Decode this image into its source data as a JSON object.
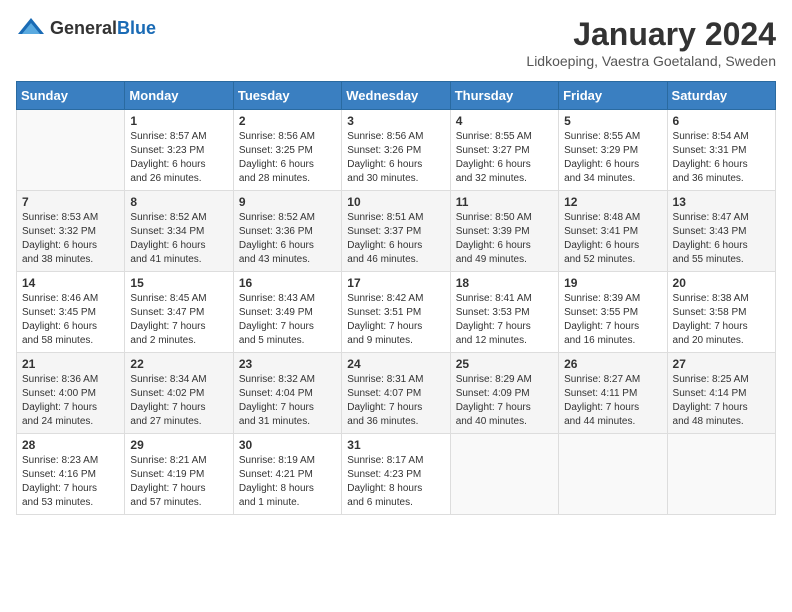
{
  "header": {
    "logo_general": "General",
    "logo_blue": "Blue",
    "month_title": "January 2024",
    "location": "Lidkoeping, Vaestra Goetaland, Sweden"
  },
  "days_of_week": [
    "Sunday",
    "Monday",
    "Tuesday",
    "Wednesday",
    "Thursday",
    "Friday",
    "Saturday"
  ],
  "weeks": [
    [
      {
        "day": "",
        "info": ""
      },
      {
        "day": "1",
        "info": "Sunrise: 8:57 AM\nSunset: 3:23 PM\nDaylight: 6 hours\nand 26 minutes."
      },
      {
        "day": "2",
        "info": "Sunrise: 8:56 AM\nSunset: 3:25 PM\nDaylight: 6 hours\nand 28 minutes."
      },
      {
        "day": "3",
        "info": "Sunrise: 8:56 AM\nSunset: 3:26 PM\nDaylight: 6 hours\nand 30 minutes."
      },
      {
        "day": "4",
        "info": "Sunrise: 8:55 AM\nSunset: 3:27 PM\nDaylight: 6 hours\nand 32 minutes."
      },
      {
        "day": "5",
        "info": "Sunrise: 8:55 AM\nSunset: 3:29 PM\nDaylight: 6 hours\nand 34 minutes."
      },
      {
        "day": "6",
        "info": "Sunrise: 8:54 AM\nSunset: 3:31 PM\nDaylight: 6 hours\nand 36 minutes."
      }
    ],
    [
      {
        "day": "7",
        "info": "Sunrise: 8:53 AM\nSunset: 3:32 PM\nDaylight: 6 hours\nand 38 minutes."
      },
      {
        "day": "8",
        "info": "Sunrise: 8:52 AM\nSunset: 3:34 PM\nDaylight: 6 hours\nand 41 minutes."
      },
      {
        "day": "9",
        "info": "Sunrise: 8:52 AM\nSunset: 3:36 PM\nDaylight: 6 hours\nand 43 minutes."
      },
      {
        "day": "10",
        "info": "Sunrise: 8:51 AM\nSunset: 3:37 PM\nDaylight: 6 hours\nand 46 minutes."
      },
      {
        "day": "11",
        "info": "Sunrise: 8:50 AM\nSunset: 3:39 PM\nDaylight: 6 hours\nand 49 minutes."
      },
      {
        "day": "12",
        "info": "Sunrise: 8:48 AM\nSunset: 3:41 PM\nDaylight: 6 hours\nand 52 minutes."
      },
      {
        "day": "13",
        "info": "Sunrise: 8:47 AM\nSunset: 3:43 PM\nDaylight: 6 hours\nand 55 minutes."
      }
    ],
    [
      {
        "day": "14",
        "info": "Sunrise: 8:46 AM\nSunset: 3:45 PM\nDaylight: 6 hours\nand 58 minutes."
      },
      {
        "day": "15",
        "info": "Sunrise: 8:45 AM\nSunset: 3:47 PM\nDaylight: 7 hours\nand 2 minutes."
      },
      {
        "day": "16",
        "info": "Sunrise: 8:43 AM\nSunset: 3:49 PM\nDaylight: 7 hours\nand 5 minutes."
      },
      {
        "day": "17",
        "info": "Sunrise: 8:42 AM\nSunset: 3:51 PM\nDaylight: 7 hours\nand 9 minutes."
      },
      {
        "day": "18",
        "info": "Sunrise: 8:41 AM\nSunset: 3:53 PM\nDaylight: 7 hours\nand 12 minutes."
      },
      {
        "day": "19",
        "info": "Sunrise: 8:39 AM\nSunset: 3:55 PM\nDaylight: 7 hours\nand 16 minutes."
      },
      {
        "day": "20",
        "info": "Sunrise: 8:38 AM\nSunset: 3:58 PM\nDaylight: 7 hours\nand 20 minutes."
      }
    ],
    [
      {
        "day": "21",
        "info": "Sunrise: 8:36 AM\nSunset: 4:00 PM\nDaylight: 7 hours\nand 24 minutes."
      },
      {
        "day": "22",
        "info": "Sunrise: 8:34 AM\nSunset: 4:02 PM\nDaylight: 7 hours\nand 27 minutes."
      },
      {
        "day": "23",
        "info": "Sunrise: 8:32 AM\nSunset: 4:04 PM\nDaylight: 7 hours\nand 31 minutes."
      },
      {
        "day": "24",
        "info": "Sunrise: 8:31 AM\nSunset: 4:07 PM\nDaylight: 7 hours\nand 36 minutes."
      },
      {
        "day": "25",
        "info": "Sunrise: 8:29 AM\nSunset: 4:09 PM\nDaylight: 7 hours\nand 40 minutes."
      },
      {
        "day": "26",
        "info": "Sunrise: 8:27 AM\nSunset: 4:11 PM\nDaylight: 7 hours\nand 44 minutes."
      },
      {
        "day": "27",
        "info": "Sunrise: 8:25 AM\nSunset: 4:14 PM\nDaylight: 7 hours\nand 48 minutes."
      }
    ],
    [
      {
        "day": "28",
        "info": "Sunrise: 8:23 AM\nSunset: 4:16 PM\nDaylight: 7 hours\nand 53 minutes."
      },
      {
        "day": "29",
        "info": "Sunrise: 8:21 AM\nSunset: 4:19 PM\nDaylight: 7 hours\nand 57 minutes."
      },
      {
        "day": "30",
        "info": "Sunrise: 8:19 AM\nSunset: 4:21 PM\nDaylight: 8 hours\nand 1 minute."
      },
      {
        "day": "31",
        "info": "Sunrise: 8:17 AM\nSunset: 4:23 PM\nDaylight: 8 hours\nand 6 minutes."
      },
      {
        "day": "",
        "info": ""
      },
      {
        "day": "",
        "info": ""
      },
      {
        "day": "",
        "info": ""
      }
    ]
  ]
}
